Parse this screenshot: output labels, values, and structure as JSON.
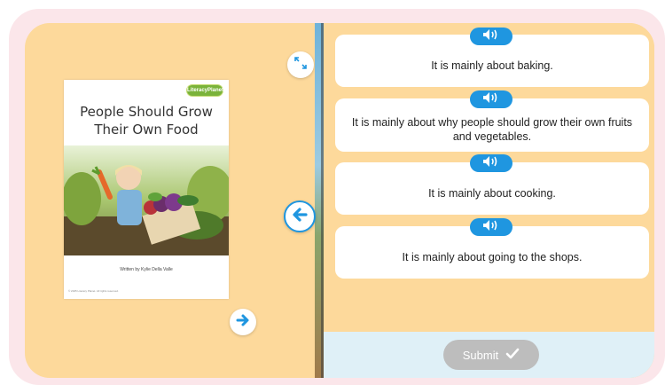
{
  "book": {
    "logo": "LiteracyPlanet",
    "title": "People Should Grow Their Own Food",
    "author": "Written by Kylie Della Valle",
    "legal": "© 2025 Literacy Planet. All rights reserved."
  },
  "controls": {
    "expand_icon": "expand-icon",
    "back_icon": "arrow-left-icon",
    "next_icon": "arrow-right-icon"
  },
  "answers": [
    {
      "text": "It is mainly about baking."
    },
    {
      "text": "It is mainly about why people should grow their own fruits and vegetables."
    },
    {
      "text": "It is mainly about cooking."
    },
    {
      "text": "It is mainly about going to the shops."
    }
  ],
  "submit": {
    "label": "Submit"
  },
  "colors": {
    "page_bg": "#fdd99b",
    "frame": "#fbe6ea",
    "audio_button": "#1f96e0",
    "submit_disabled": "#bdbdbd",
    "bottom_bar": "#dff0f7"
  }
}
